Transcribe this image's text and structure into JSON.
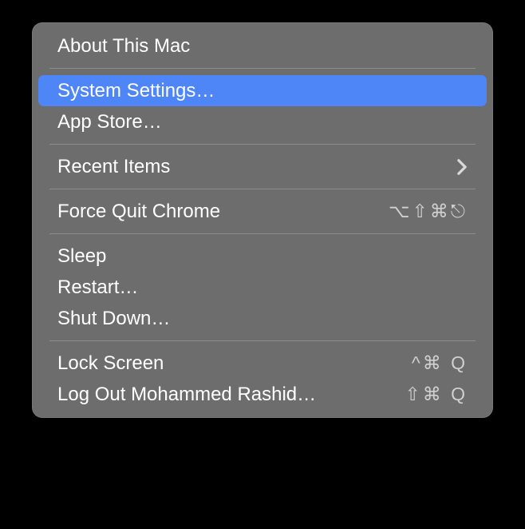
{
  "menu": {
    "about": "About This Mac",
    "systemSettings": "System Settings…",
    "appStore": "App Store…",
    "recentItems": "Recent Items",
    "forceQuit": "Force Quit Chrome",
    "forceQuitShortcut": "⌥⇧⌘⎋",
    "sleep": "Sleep",
    "restart": "Restart…",
    "shutDown": "Shut Down…",
    "lockScreen": "Lock Screen",
    "lockScreenShortcut": "^⌘ Q",
    "logOut": "Log Out Mohammed Rashid…",
    "logOutShortcut": "⇧⌘ Q"
  }
}
